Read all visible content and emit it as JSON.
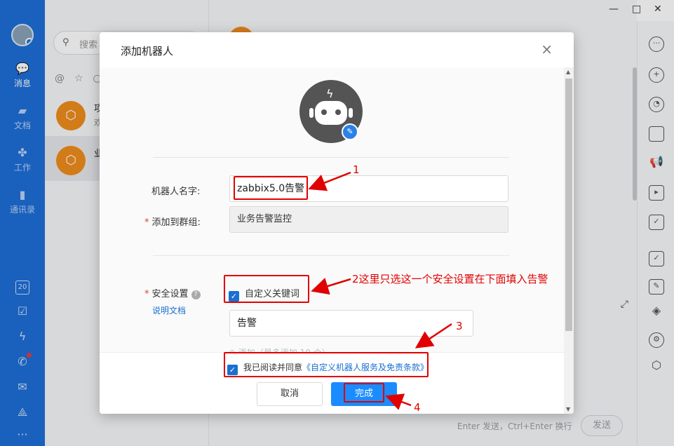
{
  "window": {
    "minimize": "—",
    "maximize": "□",
    "close": "✕"
  },
  "sidebar": {
    "items": [
      {
        "label": "消息",
        "icon": "chat-bubble-icon"
      },
      {
        "label": "文档",
        "icon": "folder-icon"
      },
      {
        "label": "工作",
        "icon": "grid-icon"
      },
      {
        "label": "通讯录",
        "icon": "contacts-icon"
      }
    ],
    "bottom_icons": [
      "calendar-icon",
      "check-square-icon",
      "lightning-icon",
      "phone-icon",
      "mail-icon",
      "network-icon",
      "more-icon"
    ],
    "calendar_day": "20"
  },
  "list": {
    "search_placeholder": "搜索",
    "conversations": [
      {
        "title": "项",
        "snippet": "欢"
      },
      {
        "title": "业",
        "snippet": ""
      }
    ]
  },
  "chat": {
    "input_hint": "Enter 发送，Ctrl+Enter 换行",
    "send_label": "发送"
  },
  "dialog": {
    "title": "添加机器人",
    "name_label": "机器人名字:",
    "name_value": "zabbix5.0告警",
    "group_label": "添加到群组:",
    "group_value": "业务告警监控",
    "security_label": "安全设置",
    "doc_link": "说明文档",
    "keyword_label": "自定义关键词",
    "keyword_value": "告警",
    "agree_prefix": "我已阅读并同意",
    "agree_link": "《自定义机器人服务及免责条款》",
    "cancel_label": "取消",
    "ok_label": "完成",
    "partial_text": "⊕ 添加（最多添加 10 个）"
  },
  "annotations": {
    "a1": "1",
    "a2": "2这里只选这一个安全设置在下面填入告警",
    "a3": "3",
    "a4": "4"
  },
  "colors": {
    "brand_blue": "#1e6fd9",
    "primary_button": "#1a8cff",
    "annotation_red": "#e10000",
    "orange_logo": "#f08d1d"
  }
}
